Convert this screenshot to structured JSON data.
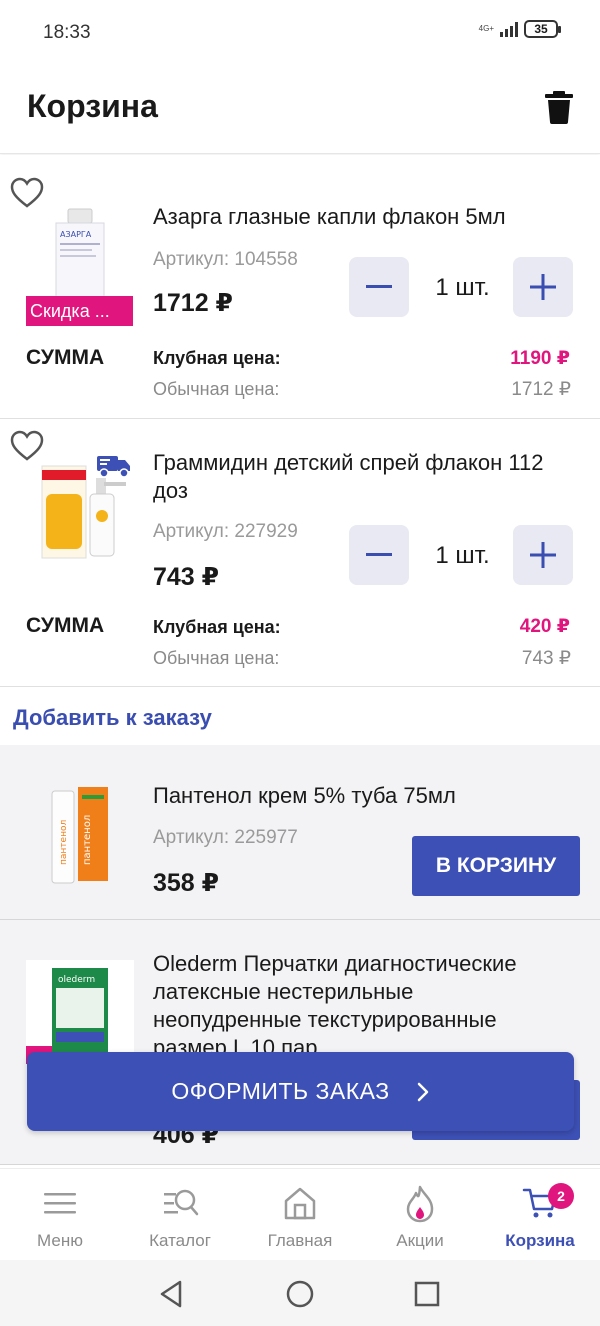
{
  "status": {
    "time": "18:33",
    "network": "4G+",
    "battery": "35"
  },
  "header": {
    "title": "Корзина",
    "trash_icon": "trash-icon"
  },
  "cart_items": [
    {
      "name": "Азарга глазные капли флакон 5мл",
      "article": "Артикул: 104558",
      "price": "1712 ₽",
      "quantity": "1 шт.",
      "badge": "Скидка ...",
      "sum_label": "СУММА",
      "club_label": "Клубная цена:",
      "club_price": "1190 ₽",
      "regular_label": "Обычная цена:",
      "regular_price": "1712 ₽"
    },
    {
      "name": "Граммидин детский спрей флакон 112 доз",
      "article": "Артикул: 227929",
      "price": "743 ₽",
      "quantity": "1 шт.",
      "sum_label": "СУММА",
      "club_label": "Клубная цена:",
      "club_price": "420 ₽",
      "regular_label": "Обычная цена:",
      "regular_price": "743 ₽"
    }
  ],
  "add_section": {
    "title": "Добавить к заказу",
    "items": [
      {
        "name": "Пантенол крем 5% туба 75мл",
        "article": "Артикул: 225977",
        "price": "358 ₽",
        "button": "В КОРЗИНУ"
      },
      {
        "name": "Olederm Перчатки диагностические латексные нестерильные неопудренные текстурированные размер L 10 пар",
        "price": "406 ₽"
      }
    ]
  },
  "order_button": "ОФОРМИТЬ ЗАКАЗ",
  "bottom_nav": {
    "items": [
      {
        "label": "Меню",
        "icon": "menu-icon"
      },
      {
        "label": "Каталог",
        "icon": "catalog-search-icon"
      },
      {
        "label": "Главная",
        "icon": "home-icon"
      },
      {
        "label": "Акции",
        "icon": "flame-icon"
      },
      {
        "label": "Корзина",
        "icon": "cart-icon",
        "badge": "2",
        "active": true
      }
    ]
  },
  "colors": {
    "accent": "#3d50b5",
    "pink": "#e0157d"
  }
}
